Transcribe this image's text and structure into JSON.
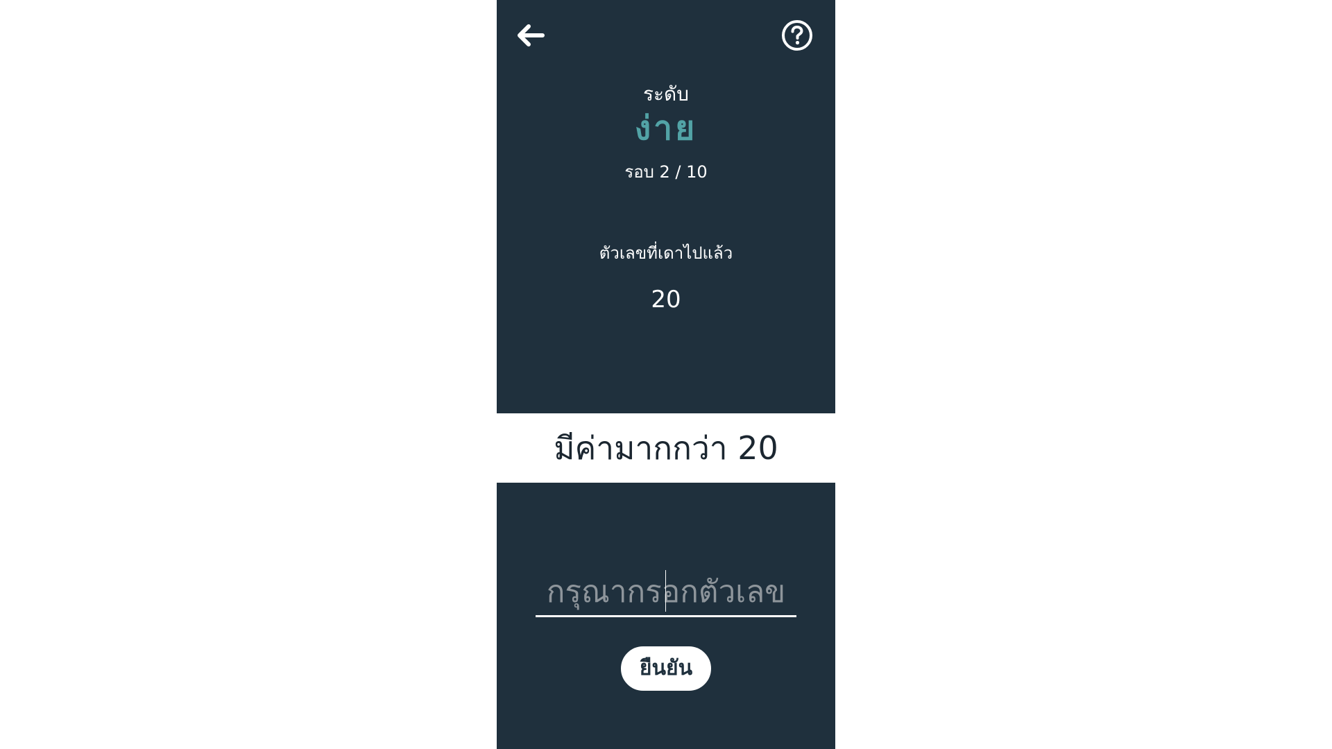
{
  "header": {
    "back_icon": "arrow-left-icon",
    "help_icon": "question-circle-icon"
  },
  "level": {
    "label": "ระดับ",
    "value": "ง่าย",
    "value_color": "#52a3a6"
  },
  "round": {
    "text": "รอบ 2 / 10"
  },
  "guessed": {
    "label": "ตัวเลขที่เดาไปแล้ว",
    "values": "20"
  },
  "hint": {
    "text": "มีค่ามากกว่า 20"
  },
  "input": {
    "value": "",
    "placeholder": "กรุณากรอกตัวเลข"
  },
  "confirm": {
    "label": "ยืนยัน"
  },
  "colors": {
    "panel": "#1f303d",
    "accent": "#52a3a6",
    "text_light": "#ffffff",
    "text_dark": "#1b2630"
  }
}
